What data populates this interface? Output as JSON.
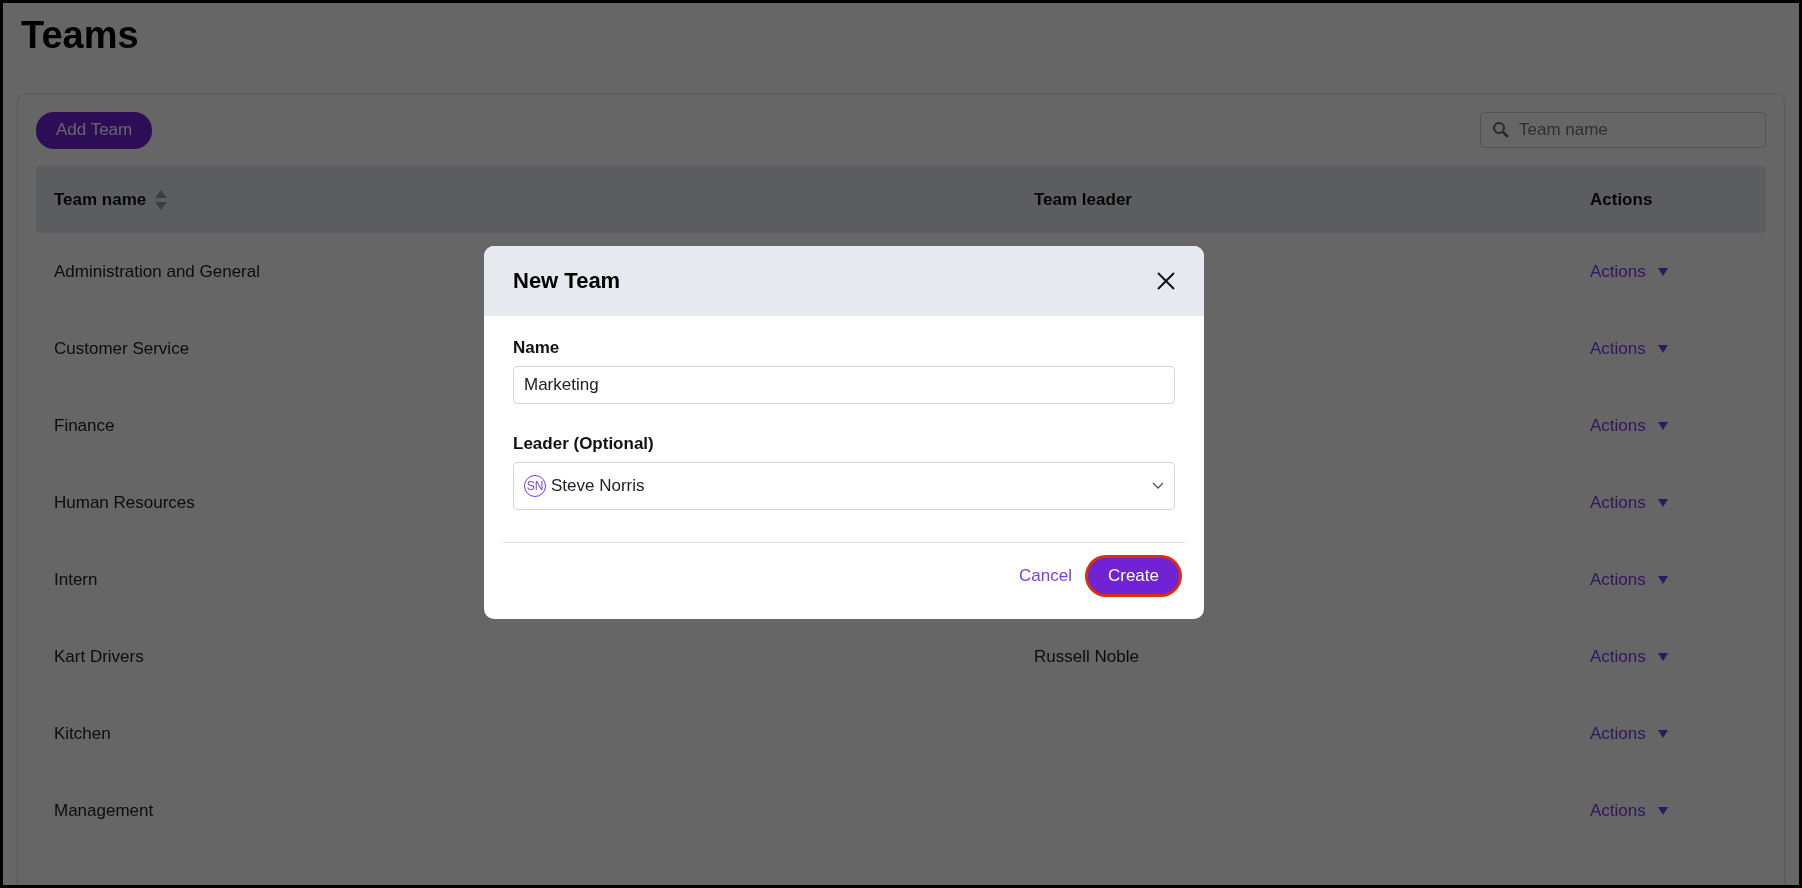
{
  "page": {
    "title": "Teams"
  },
  "toolbar": {
    "add_button": "Add Team",
    "search": {
      "placeholder": "Team name"
    }
  },
  "table": {
    "columns": [
      {
        "label": "Team name",
        "sortable": true
      },
      {
        "label": "Team leader",
        "sortable": false
      },
      {
        "label": "Actions",
        "sortable": false
      }
    ],
    "rows": [
      {
        "name": "Administration and General",
        "leader": "",
        "action": "Actions"
      },
      {
        "name": "Customer Service",
        "leader": "",
        "action": "Actions"
      },
      {
        "name": "Finance",
        "leader": "",
        "action": "Actions"
      },
      {
        "name": "Human Resources",
        "leader": "",
        "action": "Actions"
      },
      {
        "name": "Intern",
        "leader": "",
        "action": "Actions"
      },
      {
        "name": "Kart Drivers",
        "leader": "Russell Noble",
        "action": "Actions"
      },
      {
        "name": "Kitchen",
        "leader": "",
        "action": "Actions"
      },
      {
        "name": "Management",
        "leader": "",
        "action": "Actions"
      }
    ]
  },
  "dialog": {
    "title": "New Team",
    "fields": [
      {
        "label": "Name",
        "kind": "text",
        "value": "Marketing"
      },
      {
        "label": "Leader (Optional)",
        "kind": "select",
        "initials": "SN",
        "value": "Steve Norris"
      }
    ],
    "buttons": [
      {
        "label": "Cancel",
        "kind": "link",
        "focused": false
      },
      {
        "label": "Create",
        "kind": "primary",
        "focused": true
      }
    ]
  }
}
